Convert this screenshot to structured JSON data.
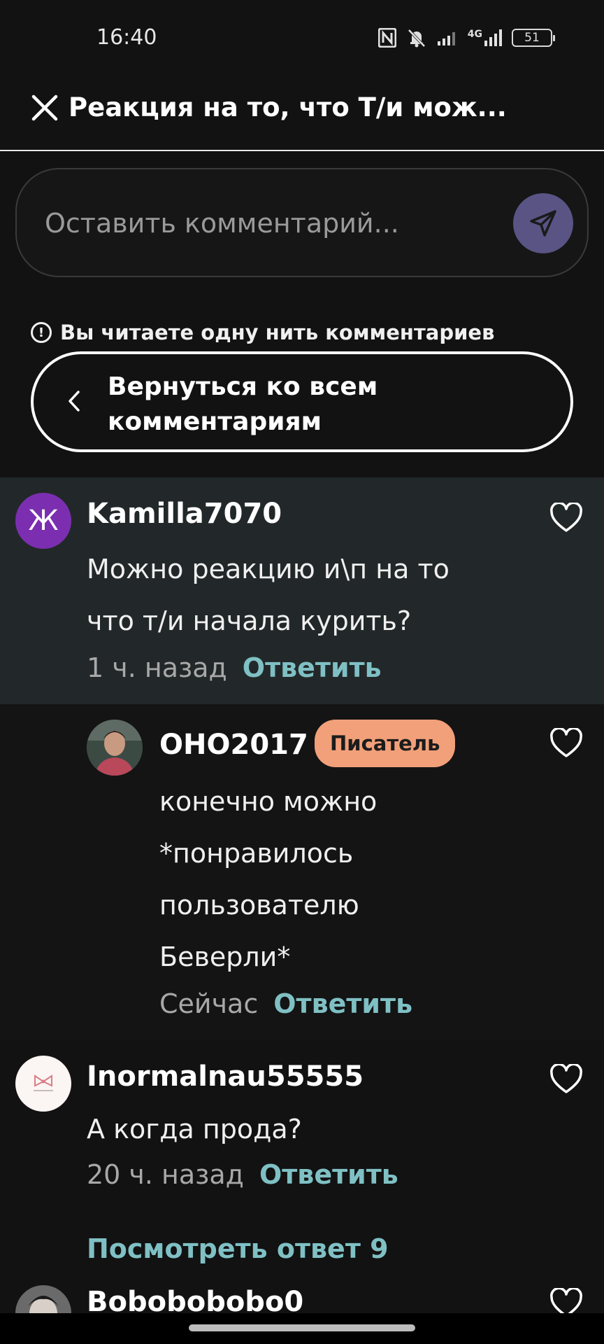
{
  "status": {
    "time": "16:40",
    "battery": "51",
    "network": "4G"
  },
  "header": {
    "title": "Реакция на то, что Т/и мож..."
  },
  "comment_input": {
    "placeholder": "Оставить комментарий..."
  },
  "thread": {
    "notice": "Вы читаете одну нить комментариев",
    "back_label": "Вернуться ко всем комментариям"
  },
  "comments": [
    {
      "username": "Kamilla7070",
      "avatar_letter": "Ж",
      "text": "Можно реакцию и\\п на то что т/и начала курить?",
      "time": "1 ч. назад",
      "reply": "Ответить"
    },
    {
      "username": "OHO2017",
      "badge": "Писатель",
      "text": "конечно можно *понравилось пользователю Беверли*",
      "time": "Сейчас",
      "reply": "Ответить"
    },
    {
      "username": "Inormalnau55555",
      "text": "А когда прода?",
      "time": "20 ч. назад",
      "reply": "Ответить"
    },
    {
      "username": "Bobobobobo0"
    }
  ],
  "view_replies": "Посмотреть ответ 9",
  "colors": {
    "accent": "#7fc0c4",
    "badge": "#f2a07a",
    "send_button": "#5a5485",
    "highlight": "#222829",
    "avatar_purple": "#7b2fb0"
  }
}
